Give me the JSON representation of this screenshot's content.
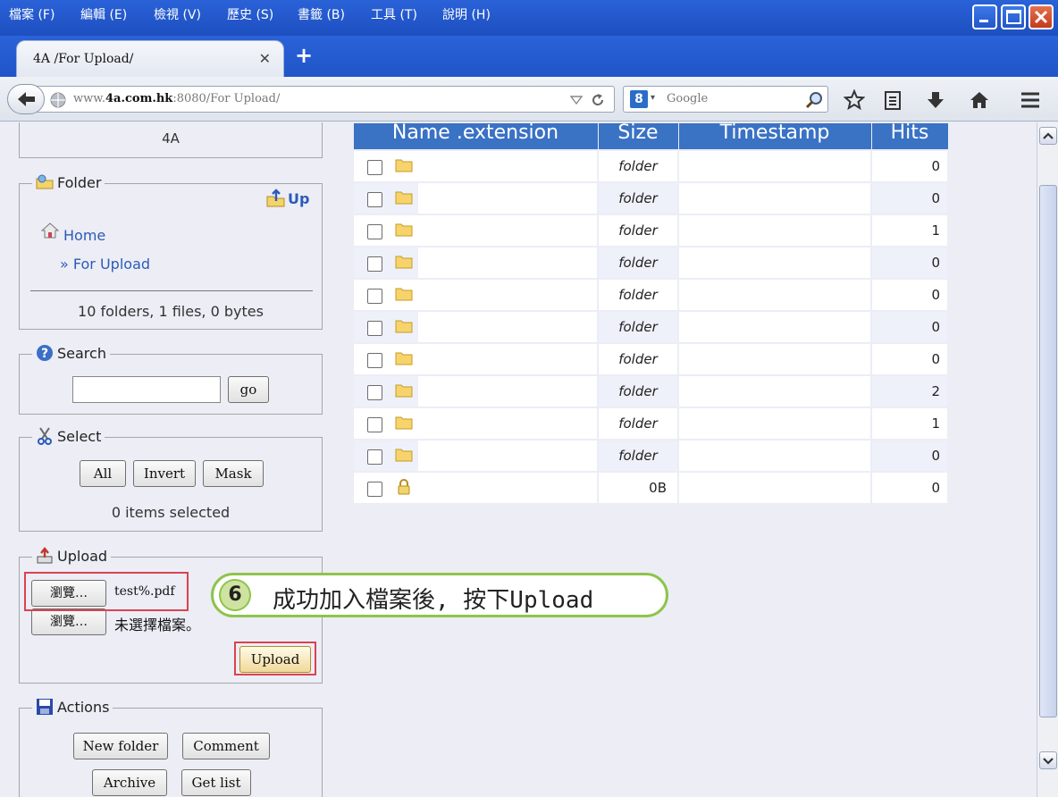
{
  "menubar": {
    "items": [
      "檔案 (F)",
      "編輯 (E)",
      "檢視 (V)",
      "歷史 (S)",
      "書籤 (B)",
      "工具 (T)",
      "說明 (H)"
    ]
  },
  "tabs": [
    {
      "title": "4A /For Upload/"
    }
  ],
  "navbar": {
    "url_prefix": "www.",
    "url_host": "4a.com.hk",
    "url_rest": ":8080/For Upload/",
    "search_placeholder": "Google"
  },
  "sidebar": {
    "top_label": "4A",
    "folder": {
      "legend": "Folder",
      "up_label": "Up",
      "home_label": "Home",
      "current_path": "» For Upload",
      "summary": "10 folders, 1 files, 0 bytes"
    },
    "search": {
      "legend": "Search",
      "value": "",
      "go_label": "go"
    },
    "select": {
      "legend": "Select",
      "buttons": [
        "All",
        "Invert",
        "Mask"
      ],
      "status": "0 items selected"
    },
    "upload": {
      "legend": "Upload",
      "browse_label": "瀏覽…",
      "file1": "test%.pdf",
      "file2": "未選擇檔案。",
      "upload_label": "Upload"
    },
    "actions": {
      "legend": "Actions",
      "buttons": [
        "New folder",
        "Comment",
        "Archive",
        "Get list"
      ]
    }
  },
  "callout": {
    "number": "6",
    "text": "成功加入檔案後, 按下Upload"
  },
  "table": {
    "headers": [
      "Name .extension",
      "Size",
      "Timestamp",
      "Hits"
    ],
    "rows": [
      {
        "type": "folder",
        "size": "folder",
        "hits": "0"
      },
      {
        "type": "folder",
        "size": "folder",
        "hits": "0"
      },
      {
        "type": "folder",
        "size": "folder",
        "hits": "1"
      },
      {
        "type": "folder",
        "size": "folder",
        "hits": "0"
      },
      {
        "type": "folder",
        "size": "folder",
        "hits": "0"
      },
      {
        "type": "folder",
        "size": "folder",
        "hits": "0"
      },
      {
        "type": "folder",
        "size": "folder",
        "hits": "0"
      },
      {
        "type": "folder",
        "size": "folder",
        "hits": "2"
      },
      {
        "type": "folder",
        "size": "folder",
        "hits": "1"
      },
      {
        "type": "folder",
        "size": "folder",
        "hits": "0"
      },
      {
        "type": "locked-file",
        "size": "0B",
        "hits": "0"
      }
    ]
  },
  "colors": {
    "titlebar": "#2a62d8",
    "table_header": "#3a72c4",
    "callout_border": "#8dc44a",
    "highlight": "#d9434f"
  }
}
